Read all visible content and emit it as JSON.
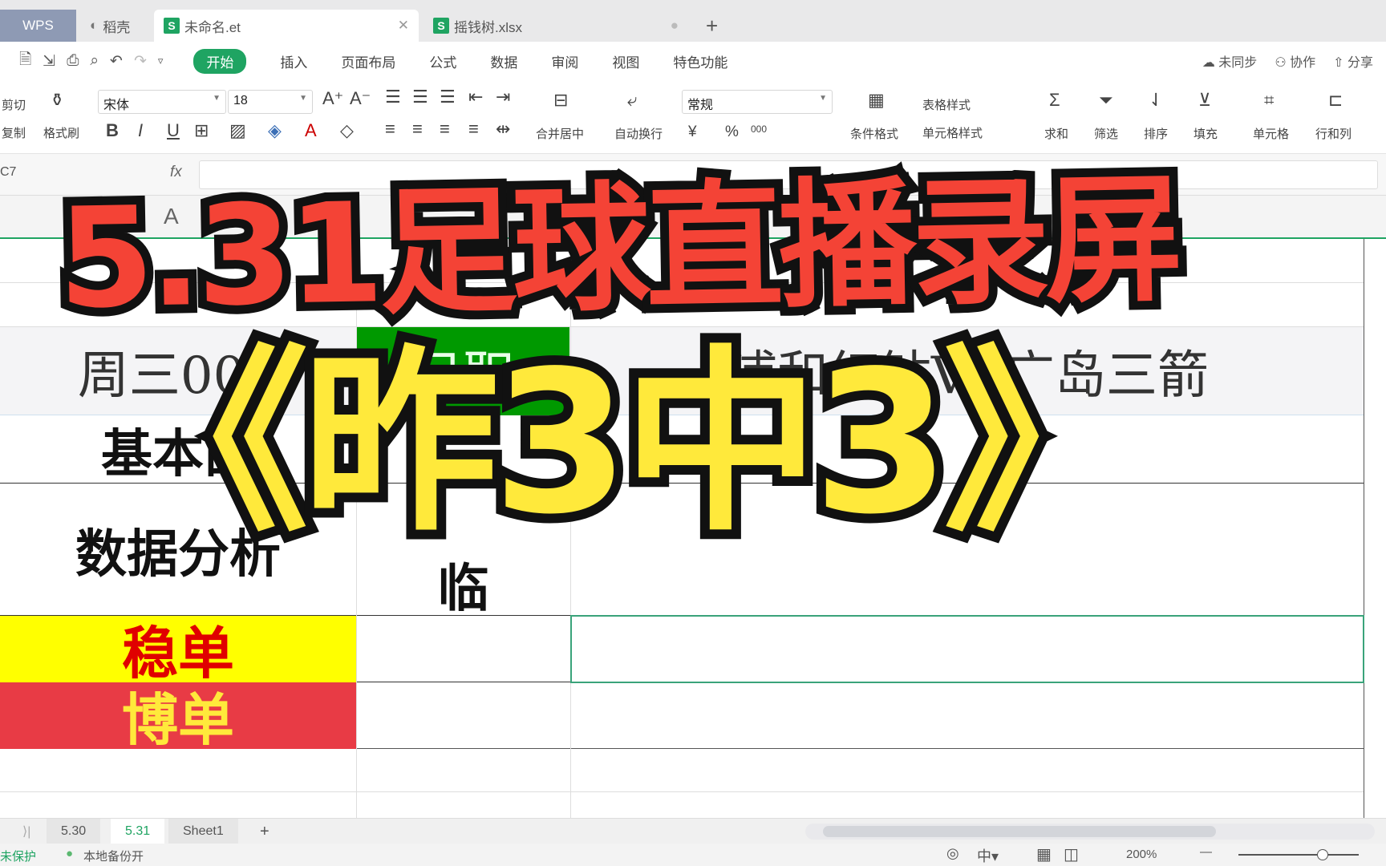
{
  "tabs": [
    {
      "label": "WPS"
    },
    {
      "label": "稻壳"
    },
    {
      "label": "未命名.et"
    },
    {
      "label": "摇钱树.xlsx"
    }
  ],
  "new_tab": "+",
  "menu": [
    "开始",
    "插入",
    "页面布局",
    "公式",
    "数据",
    "审阅",
    "视图",
    "特色功能"
  ],
  "menu_right": [
    "未同步",
    "协作",
    "分享"
  ],
  "toolbar": {
    "cut": "剪切",
    "copy": "复制",
    "format_painter": "格式刷",
    "font": "宋体",
    "size": "18",
    "merge": "合并居中",
    "wrap": "自动换行",
    "number_format": "常规",
    "currency": "¥",
    "percent": "%",
    "thousands": "000",
    "cond_format": "条件格式",
    "table_style": "表格样式",
    "cell_style": "单元格样式",
    "sum": "求和",
    "filter": "筛选",
    "sort": "排序",
    "fill": "填充",
    "cell": "单元格",
    "rowcol": "行和列"
  },
  "formula": {
    "cell_ref": "C7",
    "fx": "fx",
    "value": ""
  },
  "col_header": "A",
  "cells": {
    "a3": "周三001",
    "b3": "日职",
    "c3": "浦和红钻VS广岛三箭",
    "a4": "基本面",
    "a5": "数据分析",
    "b5": "临",
    "a7": "稳单",
    "a8": "博单"
  },
  "colors": {
    "green": "#1fa462",
    "league_green": "#009900",
    "stable_bg": "#ffff00",
    "stable_text": "#e00000",
    "risk_bg": "#e83b45",
    "risk_text": "#ffe93b",
    "title_red": "#f44336",
    "title_yellow": "#ffe93b"
  },
  "overlay": {
    "title": "5.31足球直播录屏",
    "subtitle": "《昨3中3》"
  },
  "sheets": [
    "5.30",
    "5.31",
    "Sheet1"
  ],
  "add_sheet": "+",
  "status": {
    "protect": "未保护",
    "backup": "本地备份开",
    "zoom": "200%"
  }
}
